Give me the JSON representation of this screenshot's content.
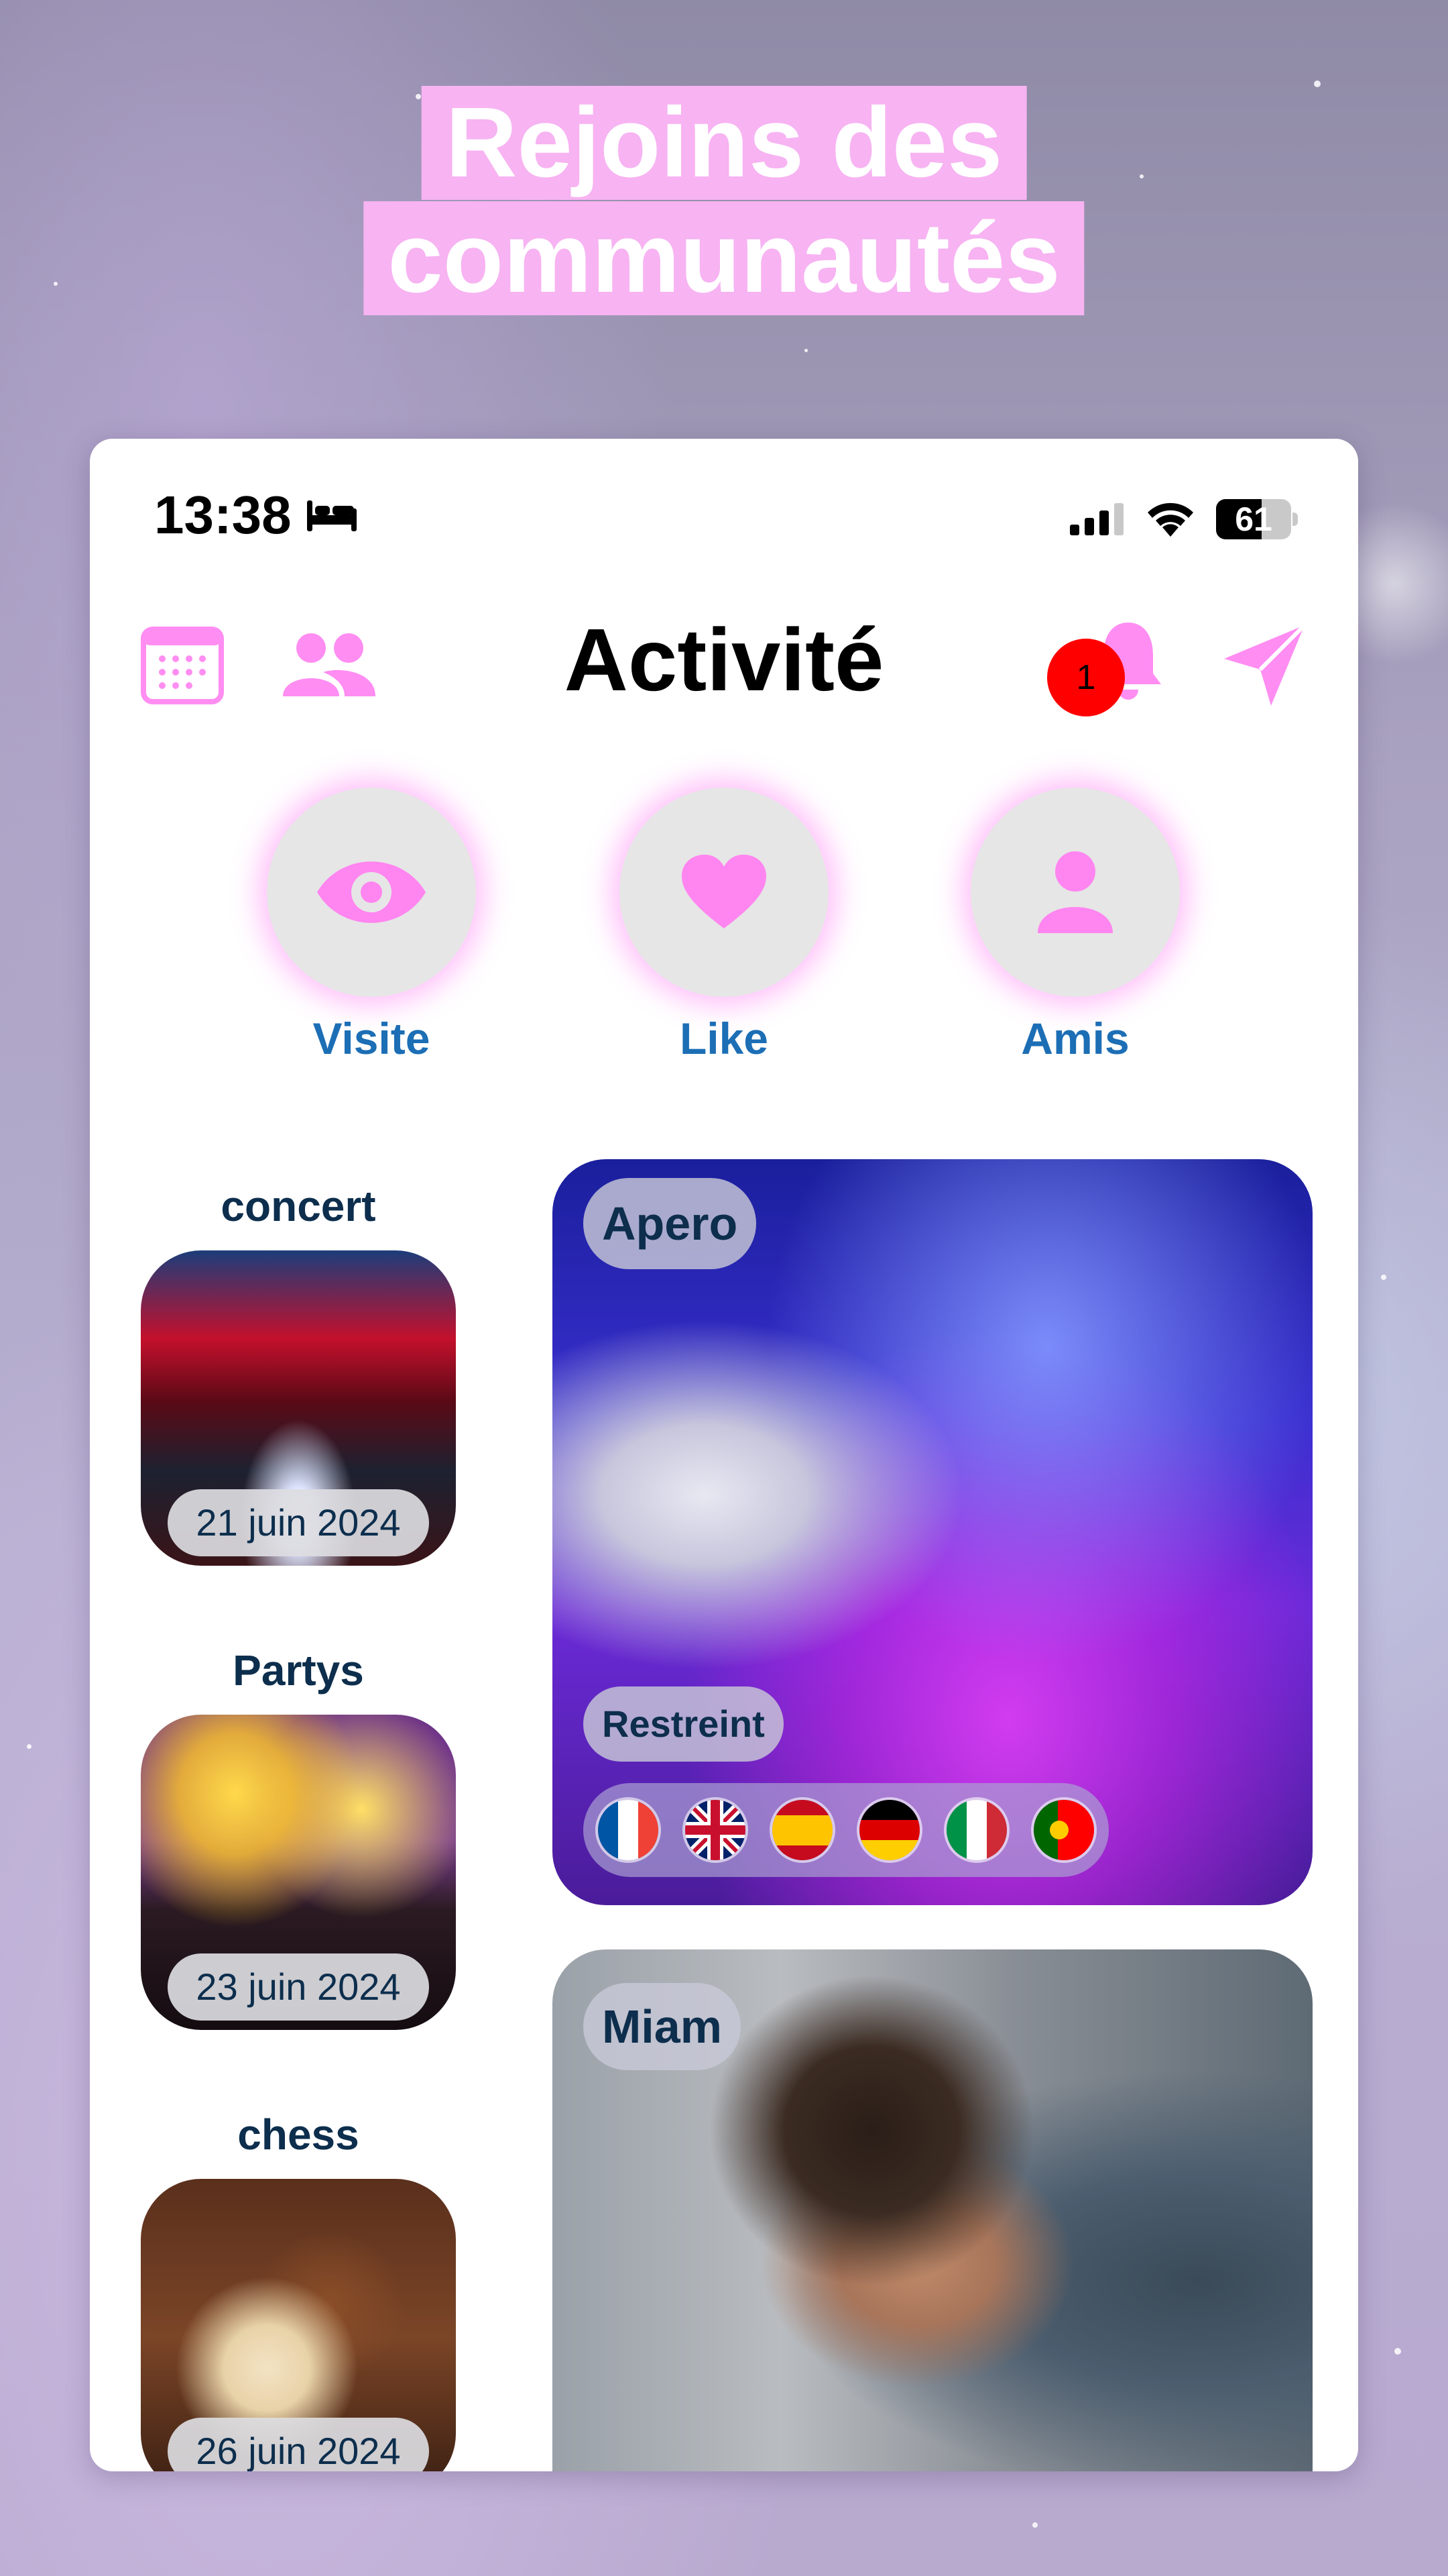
{
  "headline": {
    "line1": "Rejoins des",
    "line2": "communautés"
  },
  "status_bar": {
    "time": "13:38",
    "battery": "61",
    "battery_level": 0.61
  },
  "header": {
    "title": "Activité",
    "notification_count": "1"
  },
  "actions": [
    {
      "label": "Visite",
      "icon": "eye-icon"
    },
    {
      "label": "Like",
      "icon": "heart-icon"
    },
    {
      "label": "Amis",
      "icon": "person-icon"
    }
  ],
  "categories": [
    {
      "title": "concert",
      "date": "21 juin 2024"
    },
    {
      "title": "Partys",
      "date": "23 juin 2024"
    },
    {
      "title": "chess",
      "date": "26 juin 2024"
    }
  ],
  "cards": [
    {
      "title": "Apero",
      "tag": "Restreint",
      "flags": [
        "france-flag",
        "uk-flag",
        "spain-flag",
        "germany-flag",
        "italy-flag",
        "portugal-flag"
      ]
    },
    {
      "title": "Miam"
    }
  ],
  "colors": {
    "accent_pink": "#ff7df0",
    "label_blue": "#1c6eb5",
    "title_navy": "#0d2e4d",
    "badge_red": "#ff0000",
    "headline_bg": "#f7b3f2"
  }
}
